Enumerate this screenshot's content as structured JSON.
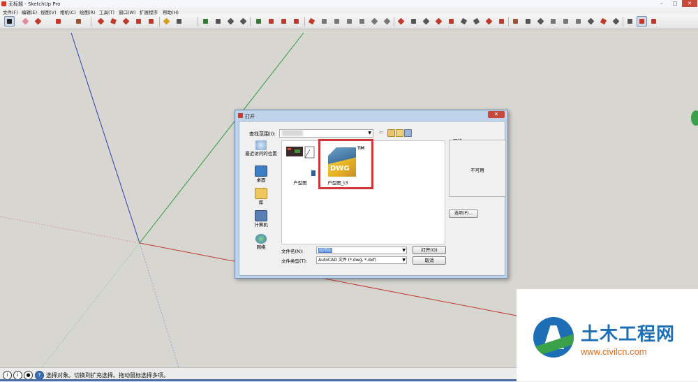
{
  "window": {
    "title": "无标题 - SketchUp Pro",
    "controls": [
      "–",
      "□",
      "✕"
    ]
  },
  "menubar": [
    "文件(F)",
    "编辑(E)",
    "视图(V)",
    "相机(C)",
    "绘图(R)",
    "工具(T)",
    "窗口(W)",
    "扩展程序",
    "帮助(H)"
  ],
  "status": {
    "message": "选择对象。切换到扩充选择。拖动鼠标选择多项。"
  },
  "dialog": {
    "title": "打开",
    "look_in_label": "查找范围(I):",
    "places": [
      "最近访问的位置",
      "桌面",
      "库",
      "计算机",
      "网络"
    ],
    "files": [
      {
        "name": "户型图",
        "type": "skp"
      },
      {
        "name": "户型图_t3",
        "type": "dwg"
      }
    ],
    "dwg_badge": "DWG",
    "dwg_tm": "TM",
    "preview_label": "预览",
    "preview_text": "不可用",
    "options_label": "选项(P)...",
    "filename_label": "文件名(N):",
    "filename_value": "圖隱圖",
    "filetype_label": "文件类型(T):",
    "filetype_value": "AutoCAD 文件 (*.dwg, *.dxf)",
    "open_label": "打开(O)",
    "cancel_label": "取消"
  },
  "watermark": {
    "title": "土木工程网",
    "url": "www.civilcn.com"
  },
  "colors": {
    "axis_red": "#c0392b",
    "axis_green": "#2e9b3a",
    "axis_blue": "#2b3fb0",
    "highlight": "#d1363b"
  }
}
